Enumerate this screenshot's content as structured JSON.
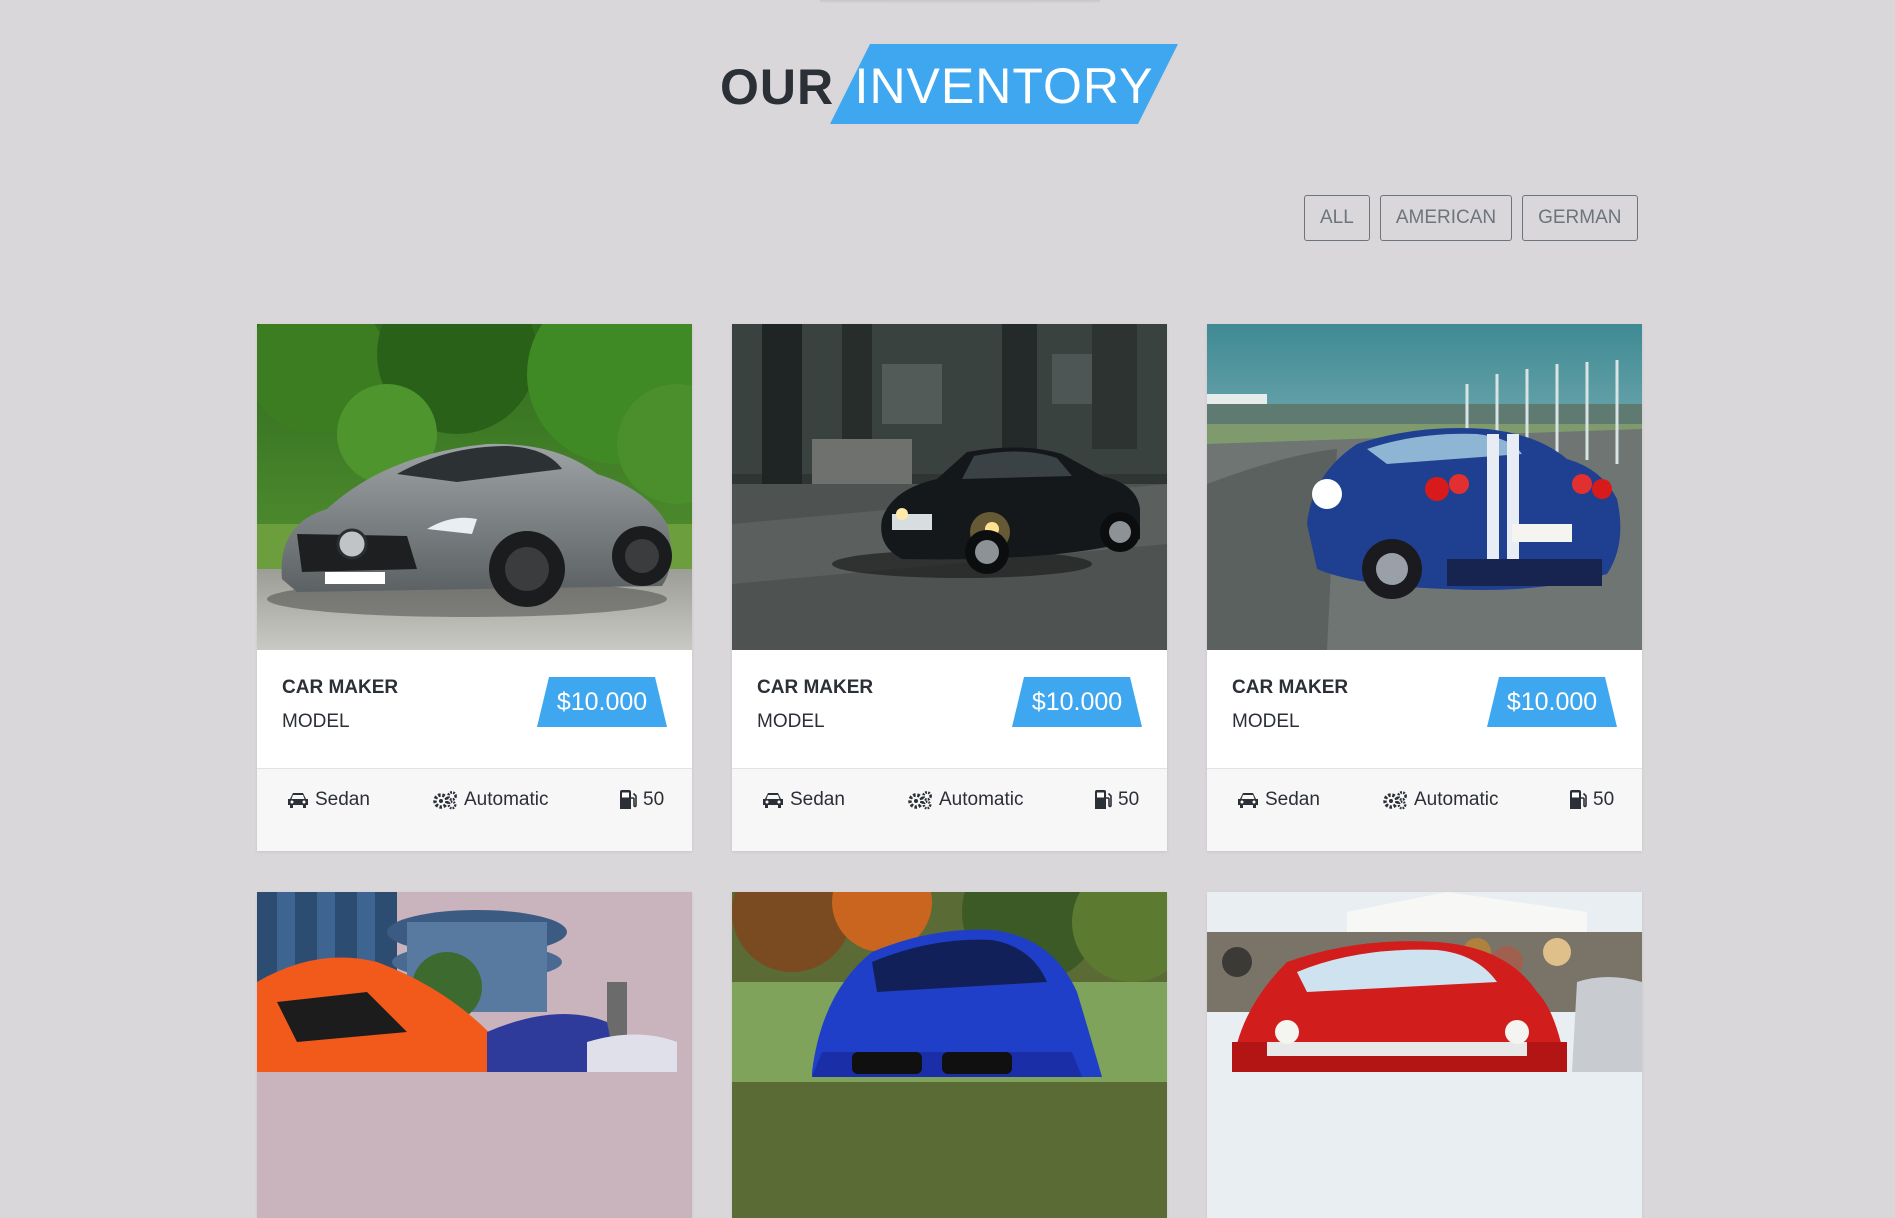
{
  "heading": {
    "our": "OUR",
    "inventory": "INVENTORY"
  },
  "filters": [
    {
      "label": "ALL"
    },
    {
      "label": "AMERICAN"
    },
    {
      "label": "GERMAN"
    }
  ],
  "cards": [
    {
      "maker": "CAR MAKER",
      "model": "MODEL",
      "price": "$10.000",
      "body": "Sedan",
      "transmission": "Automatic",
      "fuel": "50",
      "image": "silver-sports-car-photo"
    },
    {
      "maker": "CAR MAKER",
      "model": "MODEL",
      "price": "$10.000",
      "body": "Sedan",
      "transmission": "Automatic",
      "fuel": "50",
      "image": "black-sedan-photo"
    },
    {
      "maker": "CAR MAKER",
      "model": "MODEL",
      "price": "$10.000",
      "body": "Sedan",
      "transmission": "Automatic",
      "fuel": "50",
      "image": "blue-race-car-photo"
    },
    {
      "image": "orange-car-photo"
    },
    {
      "image": "blue-car-photo"
    },
    {
      "image": "red-classic-car-photo"
    }
  ],
  "colors": {
    "accent": "#3ea7ef",
    "background": "#d9d7d9",
    "text": "#2b2f36"
  },
  "icons": {
    "body": "car-icon",
    "transmission": "gears-icon",
    "fuel": "gas-pump-icon"
  }
}
